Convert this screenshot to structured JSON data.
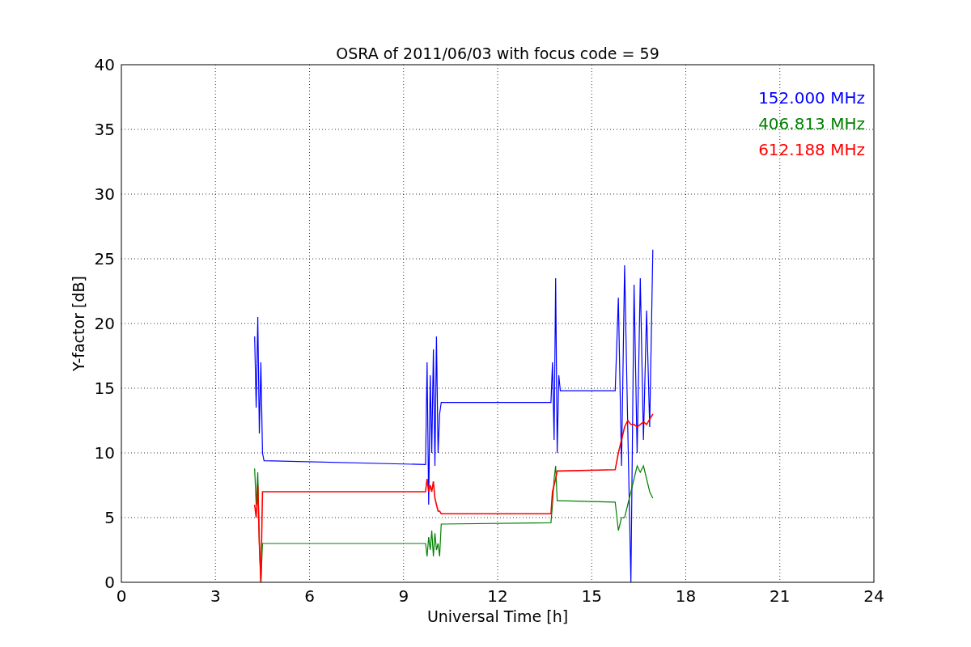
{
  "chart_data": {
    "type": "line",
    "title": "OSRA of 2011/06/03 with focus code = 59",
    "xlabel": "Universal Time [h]",
    "ylabel": "Y-factor [dB]",
    "x": [
      4.25,
      4.3,
      4.35,
      4.4,
      4.45,
      4.5,
      4.55,
      9.7,
      9.75,
      9.8,
      9.85,
      9.9,
      9.95,
      10.0,
      10.05,
      10.1,
      10.15,
      10.2,
      13.7,
      13.75,
      13.8,
      13.85,
      13.9,
      13.95,
      14.0,
      15.75,
      15.85,
      15.95,
      16.05,
      16.15,
      16.25,
      16.35,
      16.45,
      16.55,
      16.65,
      16.75,
      16.85,
      16.95
    ],
    "series": [
      {
        "name": "152.000 MHz",
        "color": "#0000ff",
        "values": [
          19,
          13.5,
          20.5,
          11.5,
          17,
          10,
          9.4,
          9.1,
          17,
          6,
          16,
          10,
          18,
          9,
          19,
          10,
          13,
          13.9,
          13.9,
          17,
          11,
          23.5,
          10,
          16,
          14.8,
          14.8,
          22,
          9,
          24.5,
          12,
          0,
          23,
          10,
          23.5,
          11,
          21,
          12,
          25.7
        ]
      },
      {
        "name": "406.813 MHz",
        "color": "#008000",
        "values": [
          8.8,
          6,
          8.5,
          3,
          0,
          3,
          3,
          3,
          2,
          3.5,
          2.5,
          4,
          2,
          3.8,
          2.5,
          3,
          2,
          4.5,
          4.6,
          6,
          8,
          9,
          6.3,
          6.3,
          6.3,
          6.2,
          4,
          5,
          5,
          6,
          7,
          8,
          9,
          8.5,
          9,
          8,
          7,
          6.5
        ]
      },
      {
        "name": "612.188 MHz",
        "color": "#ff0000",
        "values": [
          6,
          5,
          7.5,
          3,
          0,
          7,
          7,
          7,
          8,
          7,
          7.5,
          7,
          7.8,
          6.5,
          6,
          5.5,
          5.5,
          5.3,
          5.3,
          7,
          7.5,
          8,
          8.6,
          8.6,
          8.6,
          8.7,
          10,
          11,
          12,
          12.5,
          12.2,
          12.2,
          12,
          12.2,
          12.4,
          12.2,
          12.6,
          13
        ]
      }
    ],
    "xlim": [
      0,
      24
    ],
    "ylim": [
      0,
      40
    ],
    "xticks": [
      0,
      3,
      6,
      9,
      12,
      15,
      18,
      21,
      24
    ],
    "yticks": [
      0,
      5,
      10,
      15,
      20,
      25,
      30,
      35,
      40
    ],
    "grid": true
  }
}
